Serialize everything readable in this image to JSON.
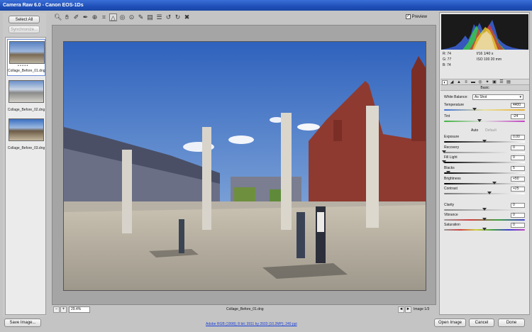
{
  "window": {
    "title": "Camera Raw 6.0  -  Canon EOS-1Ds"
  },
  "filmstrip": {
    "select_all": "Select All",
    "synchronize": "Synchronize...",
    "thumbnails": [
      {
        "filename": "Collage_Before_01.dng",
        "selected": true,
        "rating": "• • • • •"
      },
      {
        "filename": "Collage_Before_02.dng",
        "selected": false
      },
      {
        "filename": "Collage_Before_03.dng",
        "selected": false
      }
    ]
  },
  "toolbar": {
    "tools": [
      "zoom-icon",
      "hand-icon",
      "eyedropper-icon",
      "color-sampler-icon",
      "target-adjust-icon",
      "crop-icon",
      "straighten-icon",
      "redeye-icon",
      "spot-removal-icon",
      "adjust-brush-icon",
      "graduated-filter-icon",
      "preferences-icon",
      "rotate-ccw-icon",
      "rotate-cw-icon",
      "trash-icon"
    ],
    "preview_label": "Preview",
    "preview_checked": true
  },
  "canvas": {
    "filename": "Collage_Before_01.dng",
    "zoom": "29.4%",
    "image_counter": "Image 1/3"
  },
  "histogram_info": {
    "r": "R:  74",
    "g": "G:  77",
    "b": "B:  74",
    "aperture_shutter": "f/16  1/40 s",
    "iso_focal": "ISO 100  20 mm"
  },
  "panel": {
    "title": "Basic",
    "white_balance_label": "White Balance:",
    "white_balance_value": "As Shot",
    "auto": "Auto",
    "default": "Default",
    "sliders": [
      {
        "label": "Temperature",
        "value": "4400",
        "pos": 0.38
      },
      {
        "label": "Tint",
        "value": "-24",
        "pos": 0.44
      },
      {
        "label": "Exposure",
        "value": "0.00",
        "pos": 0.5
      },
      {
        "label": "Recovery",
        "value": "0",
        "pos": 0.0
      },
      {
        "label": "Fill Light",
        "value": "0",
        "pos": 0.0
      },
      {
        "label": "Blacks",
        "value": "5",
        "pos": 0.05
      },
      {
        "label": "Brightness",
        "value": "+50",
        "pos": 0.62
      },
      {
        "label": "Contrast",
        "value": "+25",
        "pos": 0.56
      },
      {
        "label": "Clarity",
        "value": "0",
        "pos": 0.5
      },
      {
        "label": "Vibrance",
        "value": "0",
        "pos": 0.5
      },
      {
        "label": "Saturation",
        "value": "0",
        "pos": 0.5
      }
    ]
  },
  "bottom": {
    "save_image": "Save Image...",
    "workflow": "Adobe RGB (1998); 8 bit; 3911 by 2603 (10.2MP); 240 ppi",
    "open_image": "Open Image",
    "cancel": "Cancel",
    "done": "Done"
  }
}
